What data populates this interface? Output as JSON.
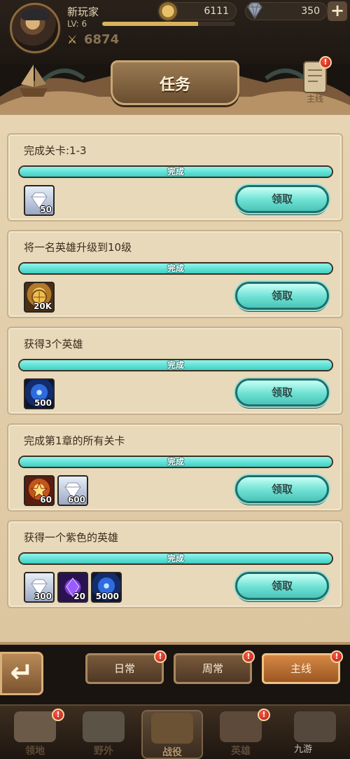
{
  "player": {
    "name": "新玩家",
    "level_label": "LV: 6",
    "xp_fraction": 0.72,
    "power": "6874"
  },
  "resources": {
    "gold": "6111",
    "diamonds": "350"
  },
  "header": {
    "title": "任务",
    "right_tab_label": "主线"
  },
  "tasks": [
    {
      "title": "完成关卡:1-3",
      "progress_label": "完成",
      "progress": 1.0,
      "claim_label": "领取",
      "rewards": [
        {
          "type": "diamond",
          "qty": "50"
        }
      ]
    },
    {
      "title": "将一名英雄升级到10级",
      "progress_label": "完成",
      "progress": 1.0,
      "claim_label": "领取",
      "rewards": [
        {
          "type": "gold",
          "qty": "20K"
        }
      ]
    },
    {
      "title": "获得3个英雄",
      "progress_label": "完成",
      "progress": 1.0,
      "claim_label": "领取",
      "rewards": [
        {
          "type": "orb",
          "qty": "500"
        }
      ]
    },
    {
      "title": "完成第1章的所有关卡",
      "progress_label": "完成",
      "progress": 1.0,
      "claim_label": "领取",
      "rewards": [
        {
          "type": "exp",
          "qty": "60"
        },
        {
          "type": "diamond",
          "qty": "600"
        }
      ]
    },
    {
      "title": "获得一个紫色的英雄",
      "progress_label": "完成",
      "progress": 1.0,
      "claim_label": "领取",
      "rewards": [
        {
          "type": "diamond",
          "qty": "300"
        },
        {
          "type": "purple",
          "qty": "20"
        },
        {
          "type": "orb",
          "qty": "5000"
        }
      ]
    }
  ],
  "tabs": [
    {
      "label": "日常",
      "active": false,
      "notify": true
    },
    {
      "label": "周常",
      "active": false,
      "notify": true
    },
    {
      "label": "主线",
      "active": true,
      "notify": true
    }
  ],
  "nav": [
    {
      "label": "领地",
      "icon": "castle-icon",
      "notify": true
    },
    {
      "label": "野外",
      "icon": "map-icon",
      "notify": false
    },
    {
      "label": "战役",
      "icon": "battle-icon",
      "notify": false,
      "active": true
    },
    {
      "label": "英雄",
      "icon": "hero-icon",
      "notify": true
    },
    {
      "label": "",
      "icon": "more-icon",
      "notify": false
    }
  ],
  "watermark": "九游",
  "colors": {
    "accent": "#4ac4b7",
    "tab_active": "#d68845",
    "notify": "#e0291c"
  }
}
